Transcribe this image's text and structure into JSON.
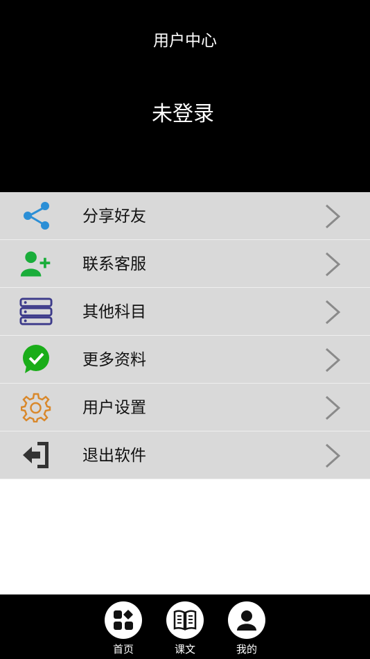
{
  "header": {
    "title": "用户中心",
    "login_status": "未登录"
  },
  "menu": {
    "items": [
      {
        "label": "分享好友",
        "icon": "share-icon",
        "color": "#2b8fd6"
      },
      {
        "label": "联系客服",
        "icon": "add-user-icon",
        "color": "#1aad3a"
      },
      {
        "label": "其他科目",
        "icon": "server-list-icon",
        "color": "#3c3a8a"
      },
      {
        "label": "更多资料",
        "icon": "check-chat-icon",
        "color": "#1aad19"
      },
      {
        "label": "用户设置",
        "icon": "gear-icon",
        "color": "#d9882b"
      },
      {
        "label": "退出软件",
        "icon": "logout-icon",
        "color": "#333333"
      }
    ],
    "background": "#d9d9d9",
    "chevron_color": "#8a8a8a"
  },
  "footer": {
    "tabs": [
      {
        "label": "首页",
        "icon": "home-grid-icon"
      },
      {
        "label": "课文",
        "icon": "book-icon"
      },
      {
        "label": "我的",
        "icon": "user-icon"
      }
    ]
  }
}
